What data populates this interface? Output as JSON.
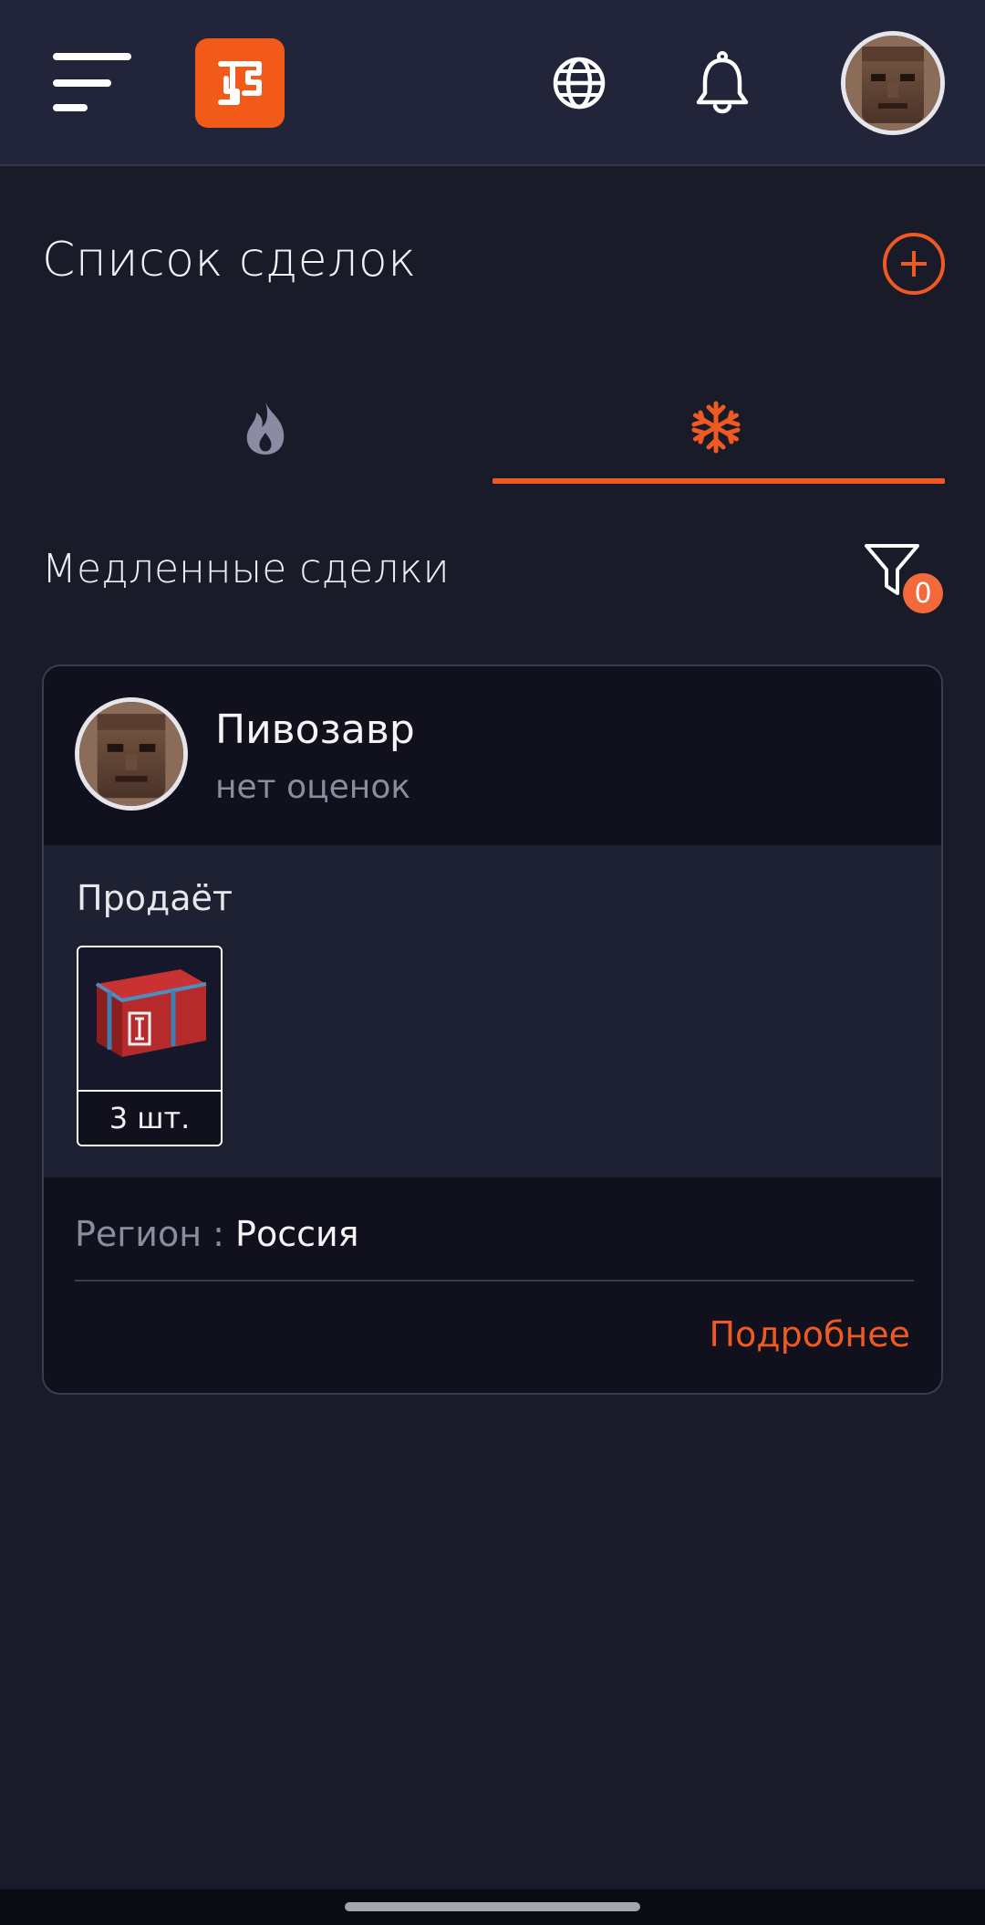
{
  "header": {
    "icons": {
      "menu": "menu-icon",
      "logo": "logo-icon",
      "language": "globe-icon",
      "notifications": "bell-icon",
      "profile": "avatar"
    }
  },
  "page": {
    "title": "Список сделок"
  },
  "tabs": [
    {
      "icon": "flame-icon",
      "active": false
    },
    {
      "icon": "snowflake-icon",
      "active": true
    }
  ],
  "section": {
    "title": "Медленные сделки",
    "filter_count": "0"
  },
  "deal": {
    "seller_name": "Пивозавр",
    "seller_rating": "нет оценок",
    "sells_label": "Продаёт",
    "item_quantity": "3 шт.",
    "region_label": "Регион :",
    "region_value": "Россия",
    "details_link": "Подробнее"
  },
  "colors": {
    "background": "#191b29",
    "header": "#22253a",
    "accent": "#f05a22",
    "card_dark": "#11101d",
    "card_mid": "#1e2131",
    "muted_text": "#8b8c9d"
  }
}
